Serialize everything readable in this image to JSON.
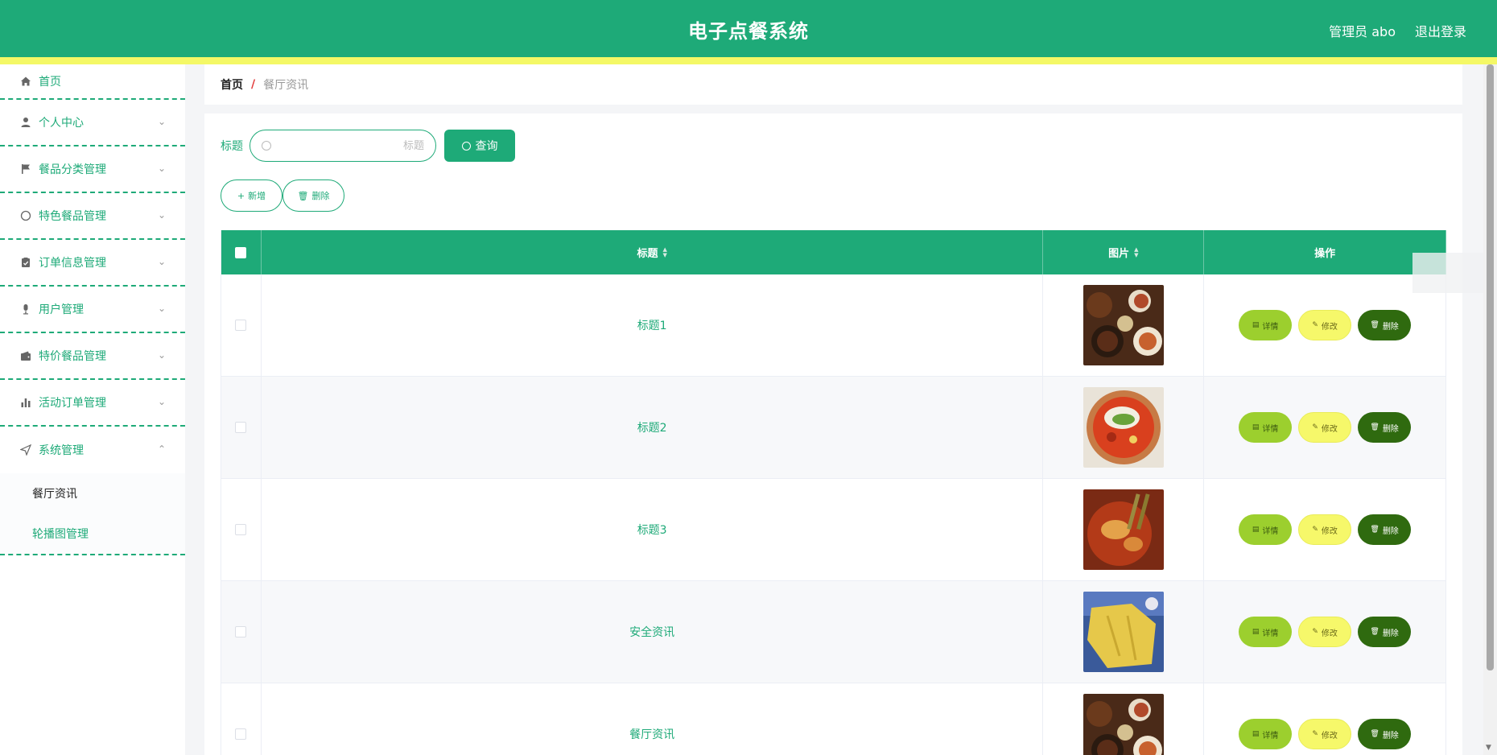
{
  "header": {
    "title": "电子点餐系统",
    "user_label": "管理员 abo",
    "logout_label": "退出登录"
  },
  "sidebar": {
    "items": [
      {
        "label": "首页",
        "icon": "home-icon"
      },
      {
        "label": "个人中心",
        "icon": "user-icon"
      },
      {
        "label": "餐品分类管理",
        "icon": "flag-icon"
      },
      {
        "label": "特色餐品管理",
        "icon": "compass-icon"
      },
      {
        "label": "订单信息管理",
        "icon": "clipboard-icon"
      },
      {
        "label": "用户管理",
        "icon": "microphone-icon"
      },
      {
        "label": "特价餐品管理",
        "icon": "wallet-icon"
      },
      {
        "label": "活动订单管理",
        "icon": "bar-chart-icon"
      },
      {
        "label": "系统管理",
        "icon": "send-icon"
      }
    ],
    "submenu": [
      {
        "label": "餐厅资讯"
      },
      {
        "label": "轮播图管理"
      }
    ]
  },
  "breadcrumb": {
    "home": "首页",
    "separator": "/",
    "current": "餐厅资讯"
  },
  "search": {
    "label": "标题",
    "placeholder": "标题",
    "button": "查询"
  },
  "actions": {
    "add": "新增",
    "delete": "删除"
  },
  "table": {
    "columns": [
      "标题",
      "图片",
      "操作"
    ],
    "rows": [
      {
        "title": "标题1",
        "image": "food-photo-1"
      },
      {
        "title": "标题2",
        "image": "food-photo-2"
      },
      {
        "title": "标题3",
        "image": "food-photo-3"
      },
      {
        "title": "安全资讯",
        "image": "food-photo-4"
      },
      {
        "title": "餐厅资讯",
        "image": "food-photo-5"
      }
    ],
    "op_labels": {
      "detail": "详情",
      "edit": "修改",
      "delete": "删除"
    }
  },
  "colors": {
    "primary": "#1eaa78",
    "header_stripe": "#f4f866",
    "detail_btn": "#9ccf2e",
    "edit_btn": "#f6f86a",
    "delete_btn": "#2f6a0f"
  }
}
